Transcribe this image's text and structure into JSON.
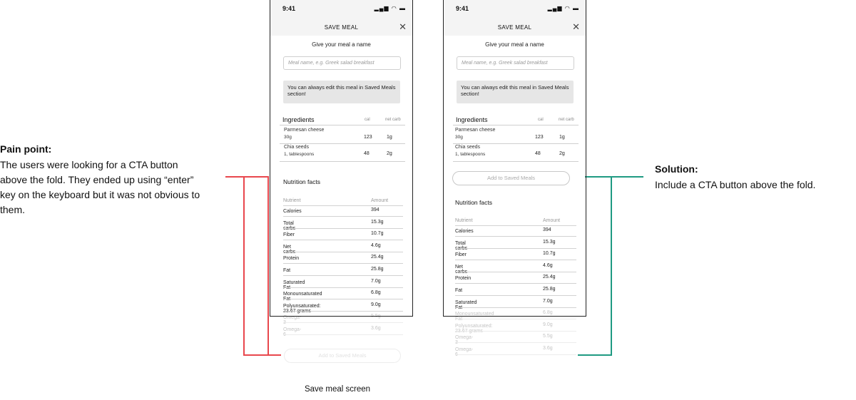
{
  "annotations": {
    "pain": {
      "title": "Pain point:",
      "lines": [
        "The users were looking for a CTA button",
        "above the fold. They ended up using “enter”",
        "key on the keyboard but it was not obvious to",
        "them."
      ],
      "color": "#e8474d"
    },
    "solution": {
      "title": "Solution:",
      "body": "Include a CTA button above the fold.",
      "color": "#1f9a82"
    }
  },
  "caption": "Save meal screen",
  "screen": {
    "status_time": "9:41",
    "header_title": "SAVE MEAL",
    "close_icon": "close-icon",
    "name_prompt": "Give your meal a name",
    "name_placeholder": "Meal name, e.g. Greek salad breakfast",
    "info_text": "You can always edit this meal in Saved Meals section!",
    "ingredients": {
      "title": "Ingredients",
      "col_cal": "cal",
      "col_net_carb": "net carb",
      "items": [
        {
          "name": "Parmesan cheese",
          "qty": "30g",
          "cal": "123",
          "net_carb": "1g"
        },
        {
          "name": "Chia seeds",
          "qty": "1, tablespoons",
          "cal": "48",
          "net_carb": "2g"
        }
      ]
    },
    "cta_label": "Add to Saved Meals",
    "nutrition": {
      "title": "Nutrition facts",
      "col_nutrient": "Nutrient",
      "col_amount": "Amount",
      "rows": [
        {
          "name": "Calories",
          "amount": "394"
        },
        {
          "name": "Total carbs",
          "amount": "15.3g"
        },
        {
          "name": "Fiber",
          "amount": "10.7g"
        },
        {
          "name": "Net carbs",
          "amount": "4.6g"
        },
        {
          "name": "Protein",
          "amount": "25.4g"
        },
        {
          "name": "Fat",
          "amount": "25.8g"
        },
        {
          "name": "Saturated Fat",
          "amount": "7.0g"
        },
        {
          "name": "Monounsaturated Fat",
          "amount": "6.8g"
        },
        {
          "name": "Polyunsaturated: 23.67 grams",
          "amount": "9.0g"
        },
        {
          "name": "Omega-3",
          "amount": "5.5g"
        },
        {
          "name": "Omega-6",
          "amount": "3.6g"
        }
      ]
    }
  }
}
